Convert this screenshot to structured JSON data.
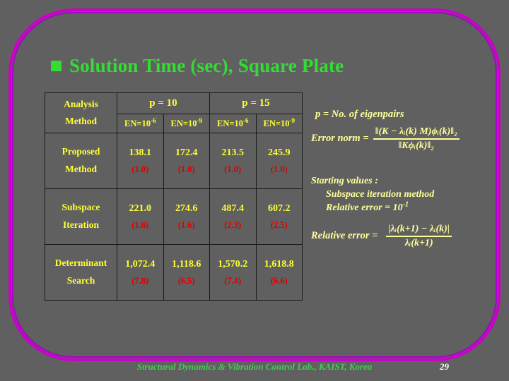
{
  "slide": {
    "title": "Solution Time (sec), Square Plate",
    "bullet_icon": "filled-square-bullet",
    "background_color": "#606060",
    "title_color": "#33DD33",
    "frame_color": "#CC00CC"
  },
  "table": {
    "header": {
      "analysis_method_line1": "Analysis",
      "analysis_method_line2": "Method",
      "group1": "p = 10",
      "group2": "p = 15",
      "subheaders": [
        "EN=10",
        "EN=10",
        "EN=10",
        "EN=10"
      ],
      "sub_exponents": [
        "-6",
        "-9",
        "-6",
        "-9"
      ]
    },
    "rows": [
      {
        "label_line1": "Proposed",
        "label_line2": "Method",
        "values": [
          "138.1",
          "172.4",
          "213.5",
          "245.9"
        ],
        "ratios": [
          "(1.0)",
          "(1.0)",
          "(1.0)",
          "(1.0)"
        ]
      },
      {
        "label_line1": "Subspace",
        "label_line2": "Iteration",
        "values": [
          "221.0",
          "274.6",
          "487.4",
          "607.2"
        ],
        "ratios": [
          "(1.6)",
          "(1.6)",
          "(2.3)",
          "(2.5)"
        ]
      },
      {
        "label_line1": "Determinant",
        "label_line2": "Search",
        "values": [
          "1,072.4",
          "1,118.6",
          "1,570.2",
          "1,618.8"
        ],
        "ratios": [
          "(7.8)",
          "(6.5)",
          "(7.4)",
          "(6.6)"
        ]
      }
    ],
    "value_color": "#FFFF33",
    "ratio_color": "#DD0000"
  },
  "notes": {
    "eigenpairs": "p = No. of eigenpairs",
    "error_norm_label": "Error norm  =",
    "error_norm_numerator": "‖(K − λᵢ(k) M)ϕᵢ(k)‖₂",
    "error_norm_denominator": "‖Kϕᵢ(k)‖₂",
    "starting_values_title": "Starting values :",
    "starting_values_line1": "Subspace iteration method",
    "starting_values_line2": "Relative error = 10",
    "starting_values_line2_exp": "-1",
    "relative_error_label": "Relative error  =",
    "relative_error_numerator": "|λᵢ(k+1) − λᵢ(k)|",
    "relative_error_denominator": "λᵢ(k+1)"
  },
  "footer": {
    "text": "Structural Dynamics & Vibration Control Lab., KAIST, Korea",
    "page_number": "29",
    "text_color": "#44CC55"
  }
}
